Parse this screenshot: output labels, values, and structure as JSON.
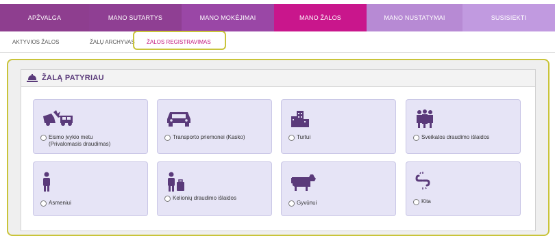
{
  "nav": {
    "items": [
      {
        "label": "APŽVALGA",
        "color": "#8e3e8f"
      },
      {
        "label": "MANO SUTARTYS",
        "color": "#8f3f93"
      },
      {
        "label": "MANO MOKĖJIMAI",
        "color": "#9a47a6"
      },
      {
        "label": "MANO ŽALOS",
        "color": "#c9168c"
      },
      {
        "label": "MANO NUSTATYMAI",
        "color": "#b78ad4"
      },
      {
        "label": "SUSISIEKTI",
        "color": "#c19ae0"
      }
    ]
  },
  "subnav": {
    "items": [
      {
        "label": "AKTYVIOS ŽALOS"
      },
      {
        "label": "ŽALŲ ARCHYVAS"
      },
      {
        "label": "ŽALOS REGISTRAVIMAS",
        "active": true
      }
    ]
  },
  "panel": {
    "title": "ŽALĄ PATYRIAU"
  },
  "cards": [
    {
      "icon": "car-accident-icon",
      "label_line1": "Eismo įvykio metu",
      "label_line2": "(Privalomasis draudimas)"
    },
    {
      "icon": "car-icon",
      "label_line1": "Transporto priemonei (Kasko)",
      "label_line2": ""
    },
    {
      "icon": "buildings-icon",
      "label_line1": "Turtui",
      "label_line2": ""
    },
    {
      "icon": "family-health-icon",
      "label_line1": "Sveikatos draudimo išlaidos",
      "label_line2": ""
    },
    {
      "icon": "person-icon",
      "label_line1": "Asmeniui",
      "label_line2": ""
    },
    {
      "icon": "traveler-icon",
      "label_line1": "Kelionių draudimo išlaidos",
      "label_line2": ""
    },
    {
      "icon": "cow-icon",
      "label_line1": "Gyvūnui",
      "label_line2": ""
    },
    {
      "icon": "chain-link-icon",
      "label_line1": "Kita",
      "label_line2": ""
    }
  ],
  "colors": {
    "icon": "#5a3a7a",
    "outline": "#c9c43a",
    "accent": "#c2187f"
  }
}
